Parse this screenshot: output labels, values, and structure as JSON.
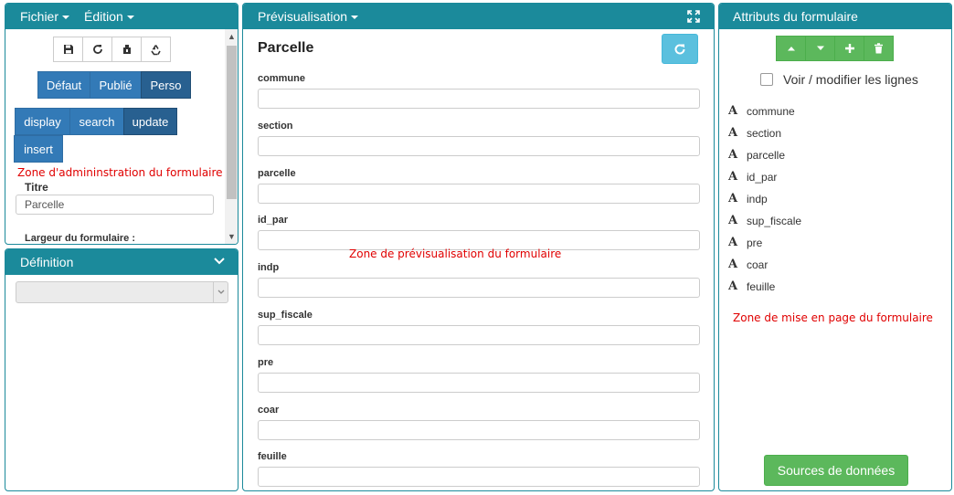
{
  "admin": {
    "menu_file": "Fichier",
    "menu_edit": "Édition",
    "tools": [
      "save-icon",
      "refresh-icon",
      "clean-icon",
      "recycle-icon"
    ],
    "status_buttons": [
      "Défaut",
      "Publié",
      "Perso"
    ],
    "mode_buttons": [
      "display",
      "search",
      "update"
    ],
    "insert_label": "insert",
    "annotation": "Zone d'admininstration du formulaire",
    "title_label": "Titre",
    "title_value": "Parcelle",
    "width_label": "Largeur du formulaire :"
  },
  "definition": {
    "title": "Définition"
  },
  "preview": {
    "header": "Prévisualisation",
    "form_title": "Parcelle",
    "fields": [
      "commune",
      "section",
      "parcelle",
      "id_par",
      "indp",
      "sup_fiscale",
      "pre",
      "coar",
      "feuille"
    ],
    "annotation": "Zone de prévisualisation du formulaire"
  },
  "attributes": {
    "header": "Attributs du formulaire",
    "checkbox_label": "Voir / modifier les lignes",
    "items": [
      "commune",
      "section",
      "parcelle",
      "id_par",
      "indp",
      "sup_fiscale",
      "pre",
      "coar",
      "feuille"
    ],
    "annotation": "Zone de mise en page du formulaire",
    "sources_button": "Sources de données"
  },
  "colors": {
    "header": "#1b8a9b",
    "primary": "#337ab7",
    "success": "#5cb85c",
    "info": "#5bc0de",
    "annotation": "#e00000"
  }
}
